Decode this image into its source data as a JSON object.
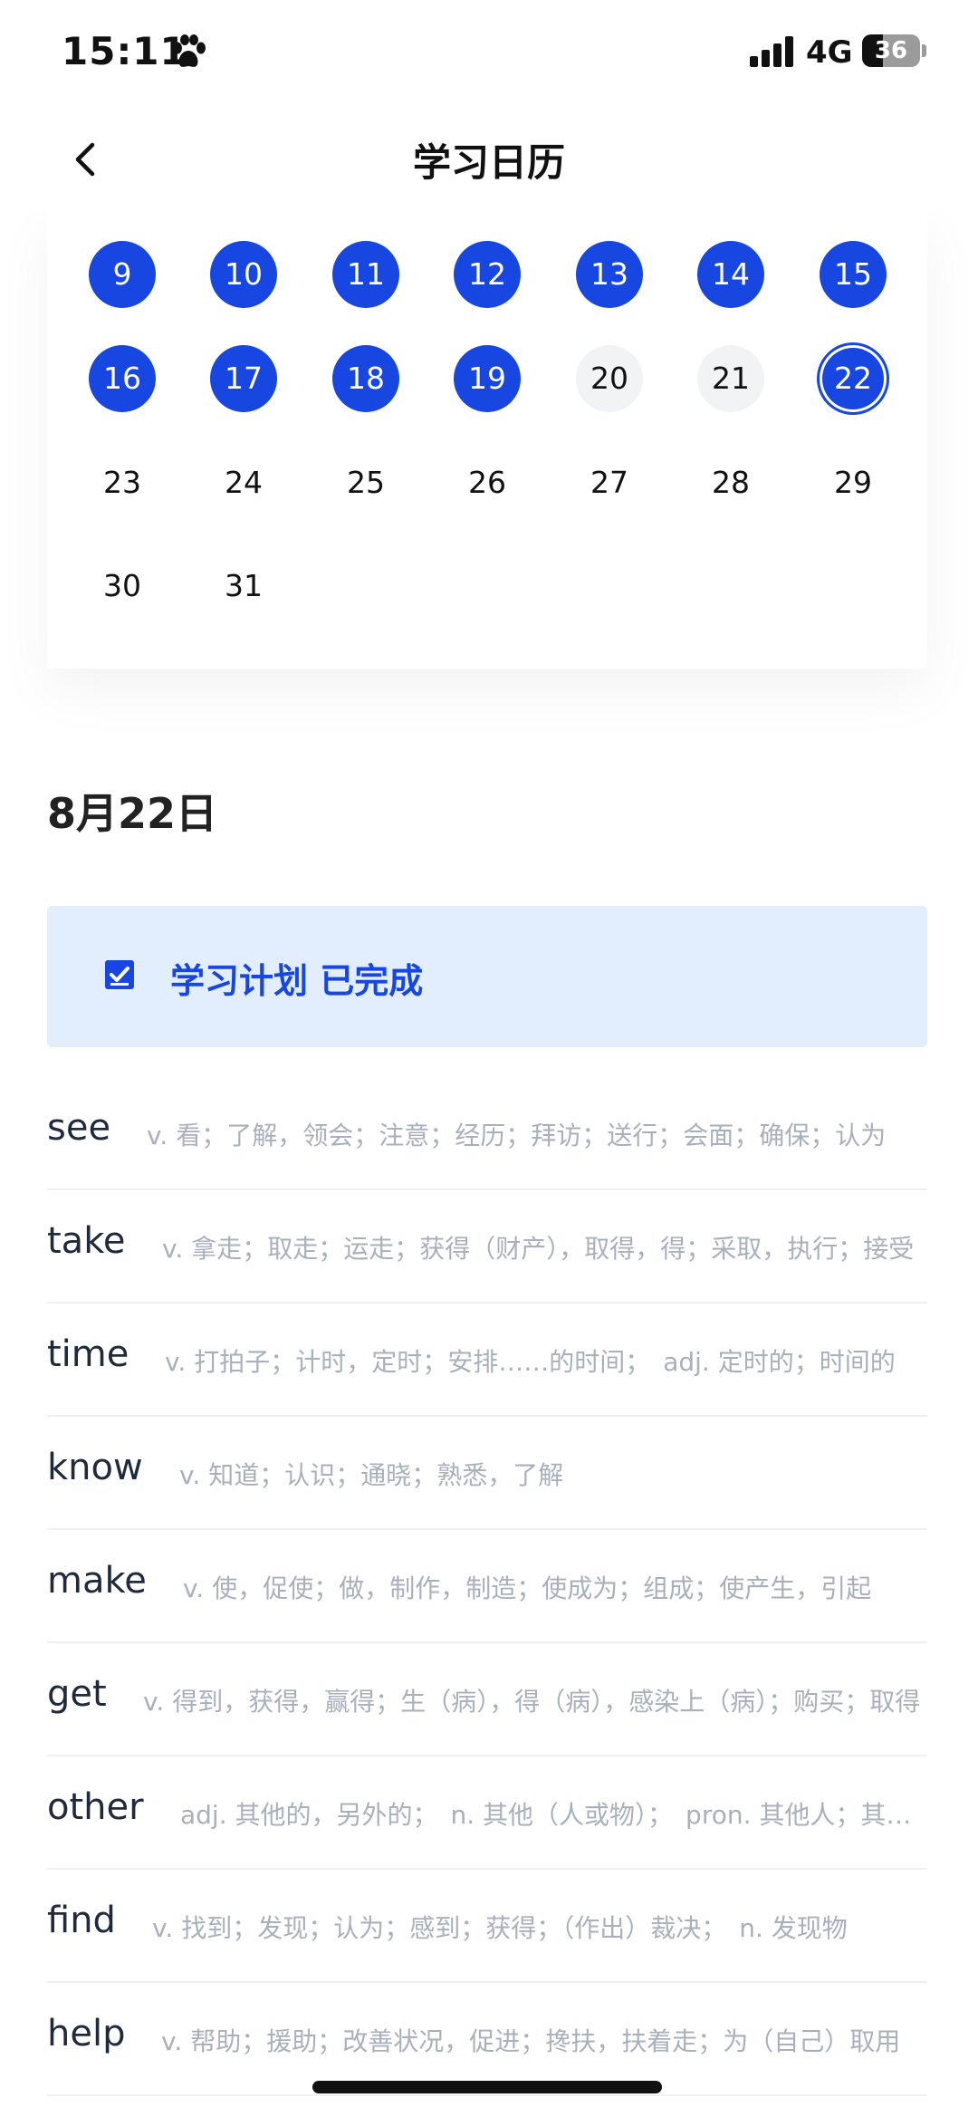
{
  "status": {
    "time": "15:11",
    "network": "4G",
    "battery": "36",
    "battery_level": 0.36
  },
  "nav": {
    "title": "学习日历"
  },
  "calendar": {
    "rows": [
      [
        {
          "day": "9",
          "state": "done"
        },
        {
          "day": "10",
          "state": "done"
        },
        {
          "day": "11",
          "state": "done"
        },
        {
          "day": "12",
          "state": "done"
        },
        {
          "day": "13",
          "state": "done"
        },
        {
          "day": "14",
          "state": "done"
        },
        {
          "day": "15",
          "state": "done"
        }
      ],
      [
        {
          "day": "16",
          "state": "done"
        },
        {
          "day": "17",
          "state": "done"
        },
        {
          "day": "18",
          "state": "done"
        },
        {
          "day": "19",
          "state": "done"
        },
        {
          "day": "20",
          "state": "missed"
        },
        {
          "day": "21",
          "state": "missed"
        },
        {
          "day": "22",
          "state": "today"
        }
      ],
      [
        {
          "day": "23",
          "state": "future"
        },
        {
          "day": "24",
          "state": "future"
        },
        {
          "day": "25",
          "state": "future"
        },
        {
          "day": "26",
          "state": "future"
        },
        {
          "day": "27",
          "state": "future"
        },
        {
          "day": "28",
          "state": "future"
        },
        {
          "day": "29",
          "state": "future"
        }
      ],
      [
        {
          "day": "30",
          "state": "future"
        },
        {
          "day": "31",
          "state": "future"
        }
      ]
    ],
    "colors": {
      "done": "#1747e0",
      "missed": "#f2f3f5"
    }
  },
  "selected_date": "8月22日",
  "plan": {
    "label": "学习计划 已完成"
  },
  "words": [
    {
      "word": "see",
      "meaning": "v. 看；了解，领会；注意；经历；拜访；送行；会面；确保；认为"
    },
    {
      "word": "take",
      "meaning": "v. 拿走；取走；运走；获得（财产），取得，得；采取，执行；接受"
    },
    {
      "word": "time",
      "meaning": "v. 打拍子；计时，定时；安排……的时间；　adj. 定时的；时间的"
    },
    {
      "word": "know",
      "meaning": "v. 知道；认识；通晓；熟悉，了解"
    },
    {
      "word": "make",
      "meaning": "v. 使，促使；做，制作，制造；使成为；组成；使产生，引起"
    },
    {
      "word": "get",
      "meaning": "v. 得到，获得，赢得；生（病），得（病），感染上（病）；购买；取得"
    },
    {
      "word": "other",
      "meaning": "adj. 其他的，另外的；　n. 其他（人或物）；　pron. 其他人；其他东西"
    },
    {
      "word": "find",
      "meaning": "v. 找到；发现；认为；感到；获得；（作出）裁决；　n. 发现物"
    },
    {
      "word": "help",
      "meaning": "v. 帮助；援助；改善状况，促进；搀扶，扶着走；为（自己）取用"
    }
  ]
}
